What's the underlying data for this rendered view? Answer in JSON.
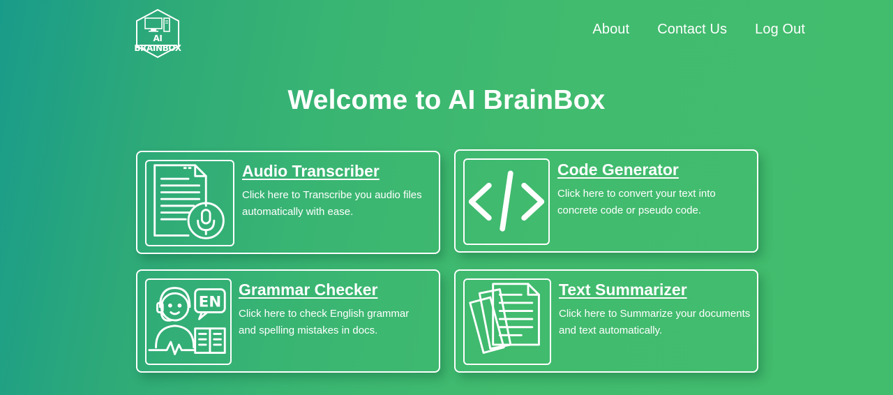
{
  "header": {
    "logo_text": "AI BRAINBOX",
    "nav": [
      {
        "label": "About"
      },
      {
        "label": "Contact Us"
      },
      {
        "label": "Log Out"
      }
    ]
  },
  "main": {
    "title": "Welcome to AI BrainBox",
    "cards": [
      {
        "title": "Audio Transcriber",
        "description": "Click here to Transcribe you audio files automatically with ease.",
        "icon": "audio-transcript-icon"
      },
      {
        "title": "Code Generator",
        "description": "Click here to convert your text into concrete code or pseudo code.",
        "icon": "code-brackets-icon"
      },
      {
        "title": "Grammar Checker",
        "description": "Click here to check English grammar and spelling mistakes in docs.",
        "icon": "grammar-student-icon"
      },
      {
        "title": "Text Summarizer",
        "description": "Click here to Summarize your documents and text automatically.",
        "icon": "documents-stack-icon"
      }
    ]
  },
  "colors": {
    "background_start": "#199b8a",
    "background_end": "#42bc6d",
    "foreground": "#ffffff"
  }
}
